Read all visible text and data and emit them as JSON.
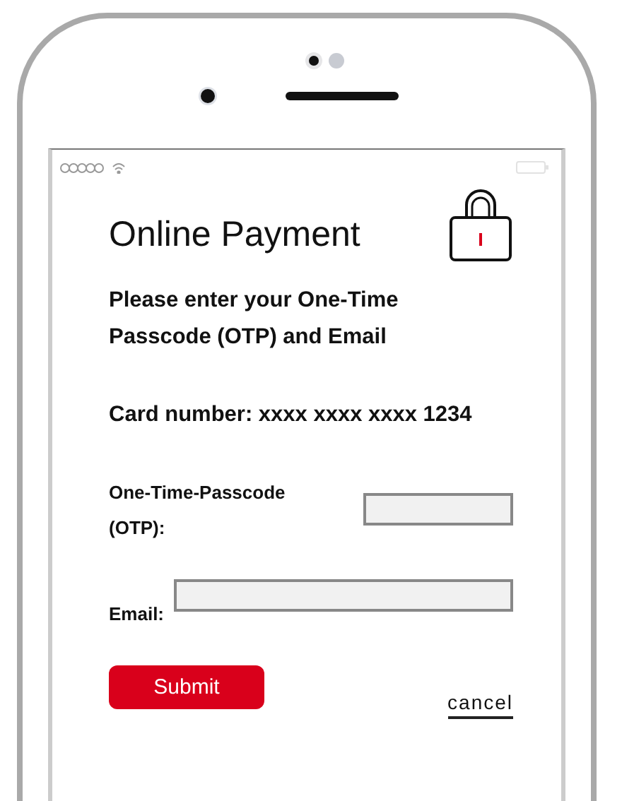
{
  "title": "Online Payment",
  "instructions": "Please enter your One-Time Passcode (OTP) and Email",
  "card_number": "Card number: xxxx xxxx xxxx 1234",
  "fields": [
    {
      "label": "One-Time-Passcode (OTP):",
      "kind": "short"
    },
    {
      "label": "Email:",
      "kind": "wide"
    }
  ],
  "submit_button": "Submit",
  "cancel_link": "cancel"
}
